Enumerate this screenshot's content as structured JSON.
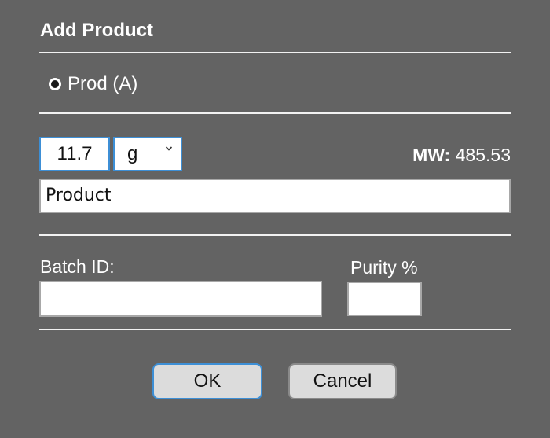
{
  "dialog": {
    "title": "Add Product"
  },
  "reactant": {
    "radio_label": "Prod (A)",
    "selected": true
  },
  "amount": {
    "value": "11.7",
    "unit": "g"
  },
  "molecular_weight": {
    "label": "MW:",
    "value": "485.53"
  },
  "product_name": {
    "value": "Product"
  },
  "batch": {
    "label": "Batch ID:",
    "value": ""
  },
  "purity": {
    "label": "Purity %",
    "value": ""
  },
  "buttons": {
    "ok": "OK",
    "cancel": "Cancel"
  },
  "icons": {
    "unit_dropdown": "chevron-down-icon",
    "radio": "radio-selected-icon"
  },
  "colors": {
    "background": "#636363",
    "focus_border": "#3d8fd6",
    "button_face": "#dcdcdc"
  }
}
